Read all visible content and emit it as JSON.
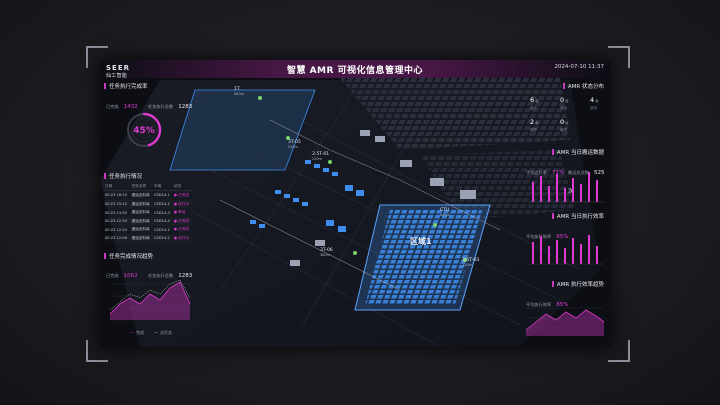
{
  "header": {
    "logo_mark": "SEER",
    "logo_sub": "仙工智能",
    "title": "智慧 AMR 可视化信息管理中心",
    "datetime": "2024-07-10 11:37"
  },
  "left": {
    "completion": {
      "title": "任务执行完成率",
      "done_label": "已完成",
      "done_value": "1432",
      "total_label": "任务执行总数",
      "total_value": "1283",
      "percent": 45,
      "percent_label": "45%"
    },
    "tasks": {
      "title": "任务执行情况",
      "columns": [
        "日期",
        "任务名称",
        "车辆",
        "状态"
      ],
      "rows": [
        [
          "00:23 16:10",
          "搬运至料库",
          "CSD14-1",
          "● 已完成"
        ],
        [
          "00:23 15:12",
          "搬运至料库",
          "CSD14-1",
          "● 执行中"
        ],
        [
          "00:23 13:30",
          "搬运至料库",
          "CSD14-3",
          "● 等待"
        ],
        [
          "00:23 12:34",
          "搬运至料库",
          "CSD14-4",
          "● 已完成"
        ],
        [
          "00:23 12:20",
          "搬运至料库",
          "CSD14-1",
          "● 已完成"
        ],
        [
          "00:23 12:08",
          "搬运至料库",
          "CSD14-2",
          "● 执行中"
        ]
      ]
    },
    "trend": {
      "title": "任务完成情况趋势",
      "done_label": "已完成",
      "done_value": "1062",
      "total_label": "任务执行总数",
      "total_value": "1283",
      "legend": [
        "完成",
        "总任务"
      ]
    }
  },
  "right": {
    "status": {
      "title": "AMR 状态分布",
      "items": [
        {
          "value": "6",
          "unit": "台",
          "label": "运行"
        },
        {
          "value": "0",
          "unit": "台",
          "label": "充电"
        },
        {
          "value": "4",
          "unit": "台",
          "label": "空闲"
        },
        {
          "value": "2",
          "unit": "台",
          "label": "故障"
        },
        {
          "value": "0",
          "unit": "台",
          "label": "离线"
        }
      ]
    },
    "daily": {
      "title": "AMR 当日搬运数据",
      "a_label": "平均运行率",
      "a_value": "71%",
      "b_label": "搬运总次数",
      "b_value": "525次"
    },
    "efficiency": {
      "title": "AMR 当日执行效率",
      "label": "平均执行效率",
      "value": "85%"
    },
    "trend": {
      "title": "AMR 执行效率趋势",
      "label": "平均执行效率",
      "value": "85%"
    }
  },
  "map": {
    "labels": [
      {
        "name": "1T",
        "sub": "000m"
      },
      {
        "name": "3T-05",
        "sub": "220m"
      },
      {
        "name": "3.5T-01",
        "sub": "220m"
      },
      {
        "name": "3T-06",
        "sub": "360m"
      },
      {
        "name": "CTU",
        "sub": "040m"
      },
      {
        "name": "3.5T-03",
        "sub": "220m"
      },
      {
        "name": "1.5T-01",
        "sub": ""
      }
    ],
    "zone_label": "区域1"
  },
  "colors": {
    "accent": "#e13ad3",
    "panel_bg": "#0c0e14",
    "blue": "#3e8ef0"
  }
}
